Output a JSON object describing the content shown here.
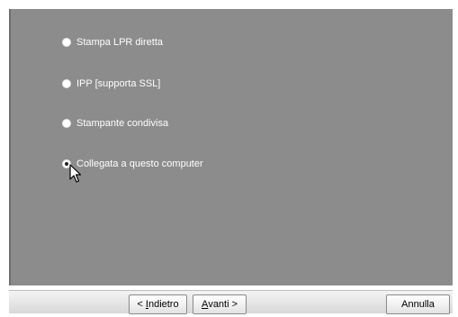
{
  "options": [
    {
      "label": "Stampa LPR diretta",
      "selected": false
    },
    {
      "label": "IPP [supporta SSL]",
      "selected": false
    },
    {
      "label": "Stampante condivisa",
      "selected": false
    },
    {
      "label": "Collegata a questo computer",
      "selected": true
    }
  ],
  "buttons": {
    "back_prefix": "< ",
    "back_accel": "I",
    "back_rest": "ndietro",
    "next_accel": "A",
    "next_rest": "vanti >",
    "cancel": "Annulla"
  },
  "colors": {
    "panel": "#8c8c8c",
    "footer": "#e6e6e6"
  },
  "icons": {
    "cursor": "arrow-pointer-icon"
  }
}
